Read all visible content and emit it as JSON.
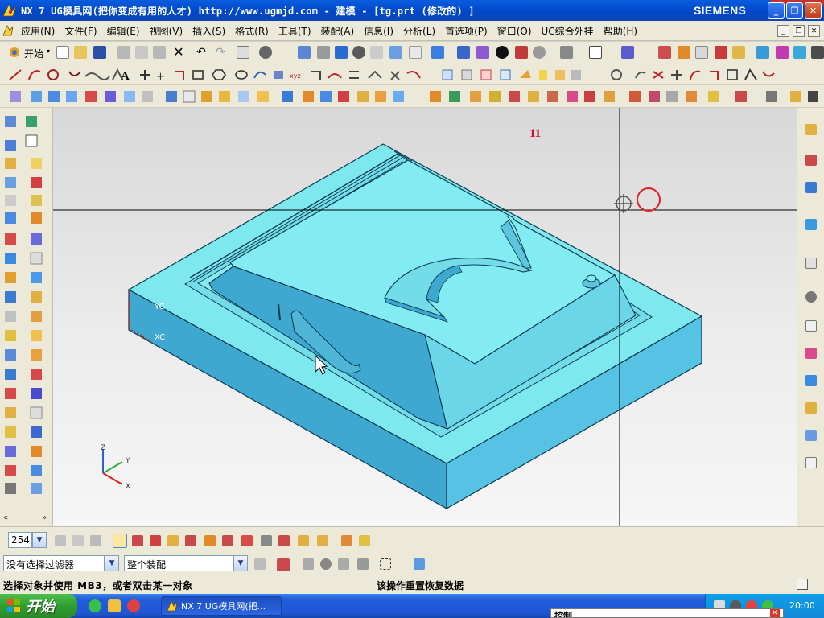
{
  "window": {
    "title": "NX 7 UG模具网(把你变成有用的人才) http://www.ugmjd.com - 建模 - [tg.prt (修改的) ]",
    "brand": "SIEMENS",
    "minimize": "_",
    "restore": "❐",
    "close": "✕"
  },
  "menubar": {
    "items": [
      "应用(N)",
      "文件(F)",
      "编辑(E)",
      "视图(V)",
      "插入(S)",
      "格式(R)",
      "工具(T)",
      "装配(A)",
      "信息(I)",
      "分析(L)",
      "首选项(P)",
      "窗口(O)",
      "UC综合外挂",
      "帮助(H)"
    ],
    "mdi_min": "_",
    "mdi_restore": "❐",
    "mdi_close": "✕"
  },
  "toolbar_standard": {
    "start_label": "开始"
  },
  "viewport": {
    "label_number": "11",
    "wcs_yc": "YC",
    "wcs_xc": "XC",
    "triad_z": "Z",
    "triad_y": "Y",
    "triad_x": "X"
  },
  "bottombar": {
    "zoom_value": "254"
  },
  "filterbar": {
    "type_filter": "没有选择过滤器",
    "scope_filter": "整个装配"
  },
  "statusbar": {
    "prompt": "选择对象并使用 MB3，或者双击某一对象",
    "status": "该操作重置恢复数据"
  },
  "taskbar": {
    "start": "开始",
    "app_button": "NX 7 UG模具网(把...",
    "clock": "20:00",
    "popup": "控制"
  },
  "colors": {
    "model_top": "#7ee8ef",
    "model_side": "#3ea8d0",
    "model_front": "#56c3e4",
    "xp_blue": "#245edb"
  }
}
